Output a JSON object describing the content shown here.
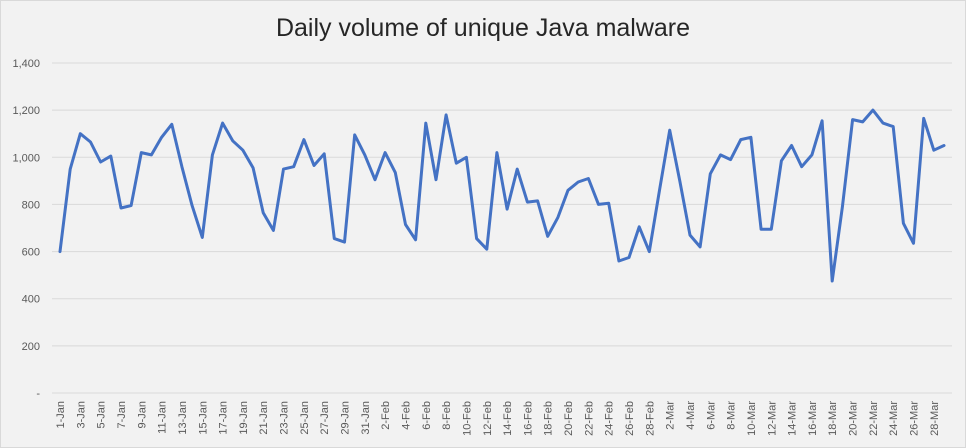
{
  "chart_data": {
    "type": "line",
    "title": "Daily volume of unique Java malware",
    "xlabel": "",
    "ylabel": "",
    "ylim": [
      0,
      1400
    ],
    "y_ticks": [
      {
        "value": 0,
        "label": "-"
      },
      {
        "value": 200,
        "label": "200"
      },
      {
        "value": 400,
        "label": "400"
      },
      {
        "value": 600,
        "label": "600"
      },
      {
        "value": 800,
        "label": "800"
      },
      {
        "value": 1000,
        "label": "1,000"
      },
      {
        "value": 1200,
        "label": "1,200"
      },
      {
        "value": 1400,
        "label": "1,400"
      }
    ],
    "grid": true,
    "legend": "none",
    "line_color": "#4472c4",
    "categories": [
      "1-Jan",
      "2-Jan",
      "3-Jan",
      "4-Jan",
      "5-Jan",
      "6-Jan",
      "7-Jan",
      "8-Jan",
      "9-Jan",
      "10-Jan",
      "11-Jan",
      "12-Jan",
      "13-Jan",
      "14-Jan",
      "15-Jan",
      "16-Jan",
      "17-Jan",
      "18-Jan",
      "19-Jan",
      "20-Jan",
      "21-Jan",
      "22-Jan",
      "23-Jan",
      "24-Jan",
      "25-Jan",
      "26-Jan",
      "27-Jan",
      "28-Jan",
      "29-Jan",
      "30-Jan",
      "31-Jan",
      "1-Feb",
      "2-Feb",
      "3-Feb",
      "4-Feb",
      "5-Feb",
      "6-Feb",
      "7-Feb",
      "8-Feb",
      "9-Feb",
      "10-Feb",
      "11-Feb",
      "12-Feb",
      "13-Feb",
      "14-Feb",
      "15-Feb",
      "16-Feb",
      "17-Feb",
      "18-Feb",
      "19-Feb",
      "20-Feb",
      "21-Feb",
      "22-Feb",
      "23-Feb",
      "24-Feb",
      "25-Feb",
      "26-Feb",
      "27-Feb",
      "28-Feb",
      "1-Mar",
      "2-Mar",
      "3-Mar",
      "4-Mar",
      "5-Mar",
      "6-Mar",
      "7-Mar",
      "8-Mar",
      "9-Mar",
      "10-Mar",
      "11-Mar",
      "12-Mar",
      "13-Mar",
      "14-Mar",
      "15-Mar",
      "16-Mar",
      "17-Mar",
      "18-Mar",
      "19-Mar",
      "20-Mar",
      "21-Mar",
      "22-Mar",
      "23-Mar",
      "24-Mar",
      "25-Mar",
      "26-Mar",
      "27-Mar",
      "28-Mar",
      "29-Mar"
    ],
    "label_every": 2,
    "values": [
      600,
      950,
      1100,
      1065,
      980,
      1005,
      785,
      795,
      1020,
      1010,
      1085,
      1140,
      960,
      795,
      660,
      1010,
      1145,
      1070,
      1030,
      955,
      765,
      690,
      950,
      960,
      1075,
      965,
      1015,
      655,
      640,
      1095,
      1010,
      905,
      1020,
      935,
      715,
      650,
      1145,
      905,
      1180,
      975,
      1000,
      655,
      610,
      1020,
      780,
      950,
      810,
      815,
      665,
      745,
      860,
      895,
      910,
      800,
      805,
      560,
      575,
      705,
      600,
      860,
      1115,
      900,
      670,
      620,
      930,
      1010,
      990,
      1075,
      1085,
      695,
      695,
      985,
      1050,
      960,
      1010,
      1155,
      475,
      790,
      1160,
      1150,
      1200,
      1145,
      1130,
      720,
      635,
      1165,
      1030,
      1050
    ]
  }
}
